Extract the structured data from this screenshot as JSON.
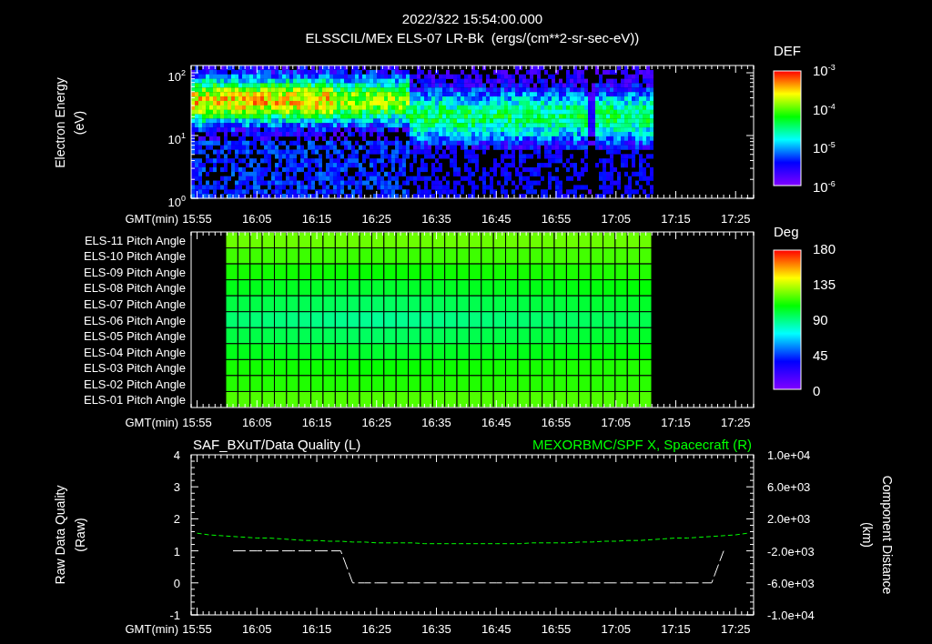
{
  "header": {
    "title": "2022/322 15:54:00.000",
    "subtitle": "ELSSCIL/MEx ELS-07 LR-Bk  (ergs/(cm**2-sr-sec-eV))"
  },
  "panels": [
    {
      "kind": "spectrogram",
      "ylabel": [
        "Electron Energy",
        "(eV)"
      ],
      "yticks": [
        "10$^{2}$",
        "10$^{1}$",
        "10$^{0}$"
      ],
      "xlabel": "GMT(min)",
      "xticks": [
        "15:55",
        "16:05",
        "16:15",
        "16:25",
        "16:35",
        "16:45",
        "16:55",
        "17:05",
        "17:15",
        "17:25"
      ],
      "colorbar": {
        "title": "DEF",
        "labels": [
          "10$^{-3}$",
          "10$^{-4}$",
          "10$^{-5}$",
          "10$^{-6}$"
        ]
      }
    },
    {
      "kind": "pitch_angle",
      "rows": [
        "ELS-11 Pitch Angle",
        "ELS-10 Pitch Angle",
        "ELS-09 Pitch Angle",
        "ELS-08 Pitch Angle",
        "ELS-07 Pitch Angle",
        "ELS-06 Pitch Angle",
        "ELS-05 Pitch Angle",
        "ELS-04 Pitch Angle",
        "ELS-03 Pitch Angle",
        "ELS-02 Pitch Angle",
        "ELS-01 Pitch Angle"
      ],
      "xlabel": "GMT(min)",
      "xticks": [
        "15:55",
        "16:05",
        "16:15",
        "16:25",
        "16:35",
        "16:45",
        "16:55",
        "17:05",
        "17:15",
        "17:25"
      ],
      "colorbar": {
        "title": "Deg",
        "labels": [
          "180",
          "135",
          "90",
          "45",
          "0"
        ]
      }
    },
    {
      "kind": "line",
      "ylabel_left": [
        "Raw Data Quality",
        "(Raw)"
      ],
      "ylabel_right": [
        "Component Distance",
        "(km)"
      ],
      "chart_data": {
        "type": "line",
        "xlabel": "GMT(min)",
        "categories": [
          "15:55",
          null,
          null,
          null,
          null,
          "16:05",
          null,
          null,
          null,
          null,
          "16:15",
          null,
          null,
          null,
          null,
          "16:25",
          null,
          null,
          null,
          null,
          "16:35",
          null,
          null,
          null,
          null,
          "16:45",
          null,
          null,
          null,
          null,
          "16:55",
          null,
          null,
          null,
          null,
          "17:05",
          null,
          null,
          null,
          null,
          "17:15",
          null,
          null,
          null,
          null,
          "17:25",
          null
        ],
        "series": [
          {
            "name": "SAF_BXuT/Data Quality (L)",
            "color": "#ffffff",
            "line_style": "dashed",
            "values": [
              null,
              null,
              null,
              1,
              1,
              1,
              1,
              1,
              1,
              1,
              1,
              1,
              1,
              0,
              0,
              0,
              0,
              0,
              0,
              0,
              0,
              0,
              0,
              0,
              0,
              0,
              0,
              0,
              0,
              0,
              0,
              0,
              0,
              0,
              0,
              0,
              0,
              0,
              0,
              0,
              0,
              0,
              0,
              0,
              1,
              null,
              null
            ]
          },
          {
            "name": "MEXORBMC/SPF X, Spacecraft (R)",
            "color": "#00ff00",
            "axis": "y2",
            "line_style": "dashed",
            "values": [
              200,
              0,
              -100,
              -200,
              -300,
              -400,
              -400,
              -500,
              -600,
              -700,
              -700,
              -800,
              -800,
              -900,
              -900,
              -1000,
              -1000,
              -1000,
              -1000,
              -1100,
              -1100,
              -1100,
              -1100,
              -1100,
              -1100,
              -1100,
              -1100,
              -1100,
              -1000,
              -1000,
              -1000,
              -1000,
              -900,
              -900,
              -800,
              -800,
              -700,
              -700,
              -600,
              -500,
              -400,
              -400,
              -300,
              -200,
              -100,
              0,
              200
            ]
          }
        ],
        "ylim": [
          -1,
          4
        ],
        "yticks": [
          4,
          3,
          2,
          1,
          0,
          -1
        ],
        "y2lim": [
          -10000,
          10000
        ],
        "y2ticks": [
          {
            "value": 10000,
            "label": "1.0e+04"
          },
          {
            "value": 6000,
            "label": "6.0e+03"
          },
          {
            "value": 2000,
            "label": "2.0e+03"
          },
          {
            "value": -2000,
            "label": "-2.0e+03"
          },
          {
            "value": -6000,
            "label": "-6.0e+03"
          },
          {
            "value": -10000,
            "label": "-1.0e+04"
          }
        ]
      }
    }
  ]
}
